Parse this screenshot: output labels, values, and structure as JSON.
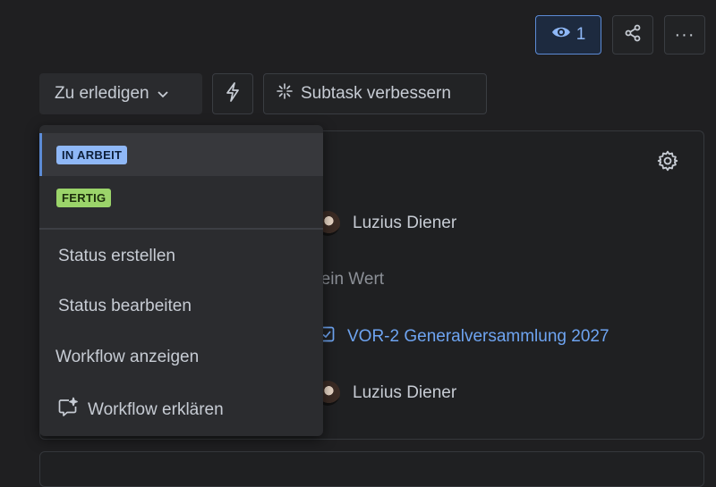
{
  "header": {
    "watch_count": "1",
    "watch_icon": "eye-icon",
    "share_icon": "share-icon",
    "more_label": "···"
  },
  "toolbar": {
    "status_label": "Zu erledigen",
    "improve_label": "Subtask verbessern"
  },
  "fields": {
    "assignee": "Luzius Diener",
    "empty_value": "Kein Wert",
    "parent": "VOR-2 Generalversammlung 2027",
    "reporter": "Luzius Diener"
  },
  "dropdown": {
    "statuses": [
      {
        "label": "IN ARBEIT",
        "color": "#8fb8f7",
        "text_color": "#0d1f3a"
      },
      {
        "label": "FERTIG",
        "color": "#9bd46a",
        "text_color": "#1c2d0c"
      }
    ],
    "actions": {
      "create": "Status erstellen",
      "edit": "Status bearbeiten",
      "show_workflow": "Workflow anzeigen",
      "explain_workflow": "Workflow erklären"
    }
  },
  "colors": {
    "background": "#1f1f21",
    "accent": "#5c8bd6",
    "link": "#6ea4f1"
  }
}
